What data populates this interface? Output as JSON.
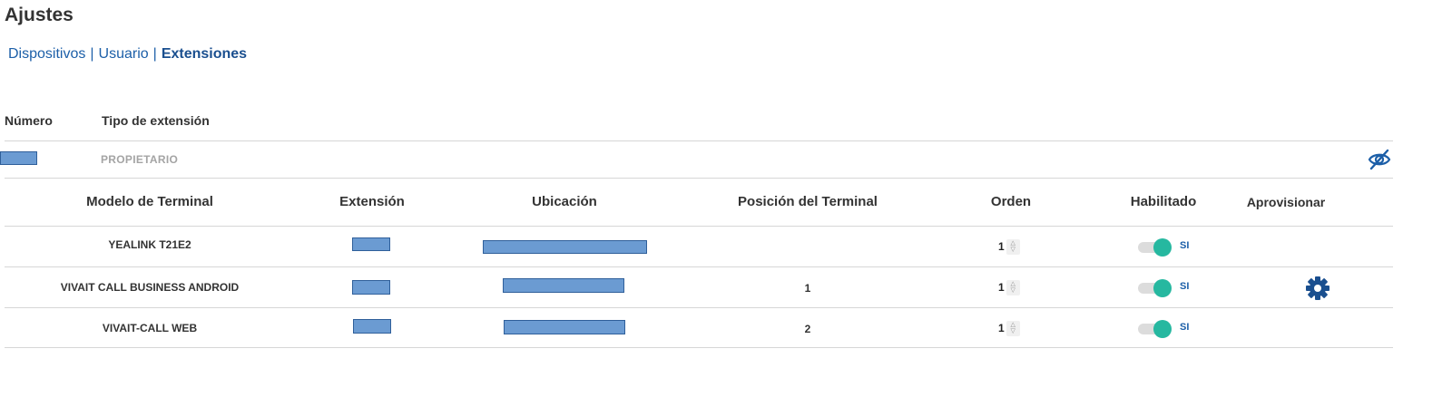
{
  "page": {
    "title": "Ajustes"
  },
  "nav": {
    "items": [
      {
        "label": "Dispositivos"
      },
      {
        "label": "Usuario"
      },
      {
        "label": "Extensiones"
      }
    ],
    "separator": "|",
    "active": "Extensiones"
  },
  "extensions_table": {
    "headers": {
      "number": "Número",
      "type": "Tipo de extensión"
    },
    "row": {
      "type": "PROPIETARIO",
      "visibility_icon": "eye-slash-icon"
    }
  },
  "terminals": {
    "headers": {
      "model": "Modelo de Terminal",
      "extension": "Extensión",
      "location": "Ubicación",
      "position": "Posición del Terminal",
      "order": "Orden",
      "enabled": "Habilitado",
      "provision": "Aprovisionar"
    },
    "rows": [
      {
        "model": "YEALINK T21E2",
        "position": "",
        "order": "1",
        "enabled_label": "SI",
        "provision_icon": ""
      },
      {
        "model": "VIVAIT CALL BUSINESS ANDROID",
        "position": "1",
        "order": "1",
        "enabled_label": "SI",
        "provision_icon": "gear-icon"
      },
      {
        "model": "VIVAIT-CALL WEB",
        "position": "2",
        "order": "1",
        "enabled_label": "SI",
        "provision_icon": ""
      }
    ]
  },
  "colors": {
    "link": "#1c5fa8",
    "toggle_on": "#26b8a0",
    "redaction": "#6b9bd2",
    "gear": "#1a4f8f"
  }
}
